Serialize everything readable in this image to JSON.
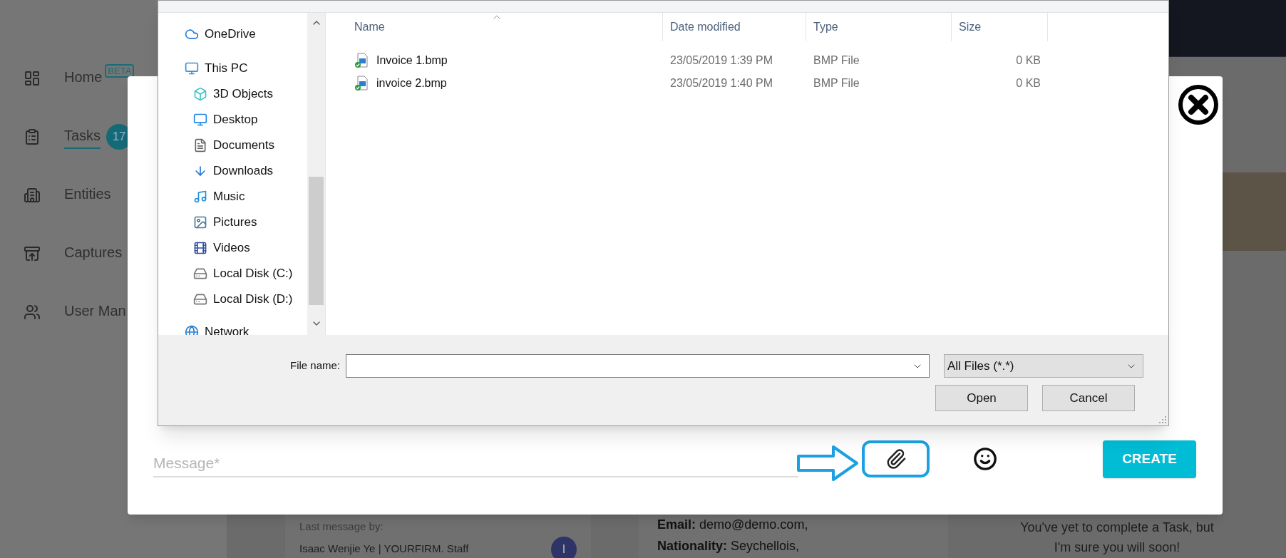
{
  "sidebar": {
    "items": [
      {
        "label": "Home",
        "selected": false,
        "badge": {
          "kind": "outline",
          "text": "BETA"
        }
      },
      {
        "label": "Tasks",
        "selected": true,
        "badge": {
          "kind": "count",
          "text": "17"
        }
      },
      {
        "label": "Entities",
        "selected": false
      },
      {
        "label": "Captures",
        "selected": false
      },
      {
        "label": "User Man",
        "selected": false
      }
    ]
  },
  "cards": {
    "last_message": {
      "caption": "Last message by:",
      "author": "Isaac Wenjie Ye | YOURFIRM. Staff",
      "avatar": "I"
    },
    "details": [
      {
        "label": "Email:",
        "value": "demo@demo.com,"
      },
      {
        "label": "Nationality:",
        "value": "Seychellois,"
      }
    ],
    "tasks_message": "You've yet to complete a Task, but I'm sure you will soon!"
  },
  "modal": {
    "message_field": {
      "placeholder": "Message*"
    },
    "create_button": "CREATE"
  },
  "file_dialog": {
    "nav": [
      {
        "label": "OneDrive"
      },
      {
        "label": "This PC",
        "children": [
          {
            "label": "3D Objects"
          },
          {
            "label": "Desktop"
          },
          {
            "label": "Documents"
          },
          {
            "label": "Downloads"
          },
          {
            "label": "Music"
          },
          {
            "label": "Pictures"
          },
          {
            "label": "Videos"
          },
          {
            "label": "Local Disk (C:)"
          },
          {
            "label": "Local Disk (D:)"
          }
        ]
      },
      {
        "label": "Network"
      }
    ],
    "columns": [
      {
        "label": "Name",
        "sorted": true
      },
      {
        "label": "Date modified",
        "sorted": false
      },
      {
        "label": "Type",
        "sorted": false
      },
      {
        "label": "Size",
        "sorted": false
      }
    ],
    "files": [
      {
        "name": "Invoice 1.bmp",
        "date": "23/05/2019 1:39 PM",
        "type": "BMP File",
        "size": "0 KB"
      },
      {
        "name": "invoice 2.bmp",
        "date": "23/05/2019 1:40 PM",
        "type": "BMP File",
        "size": "0 KB"
      }
    ],
    "file_name": {
      "label": "File name:"
    },
    "filter": "All Files (*.*)",
    "buttons": [
      "Open",
      "Cancel"
    ]
  }
}
